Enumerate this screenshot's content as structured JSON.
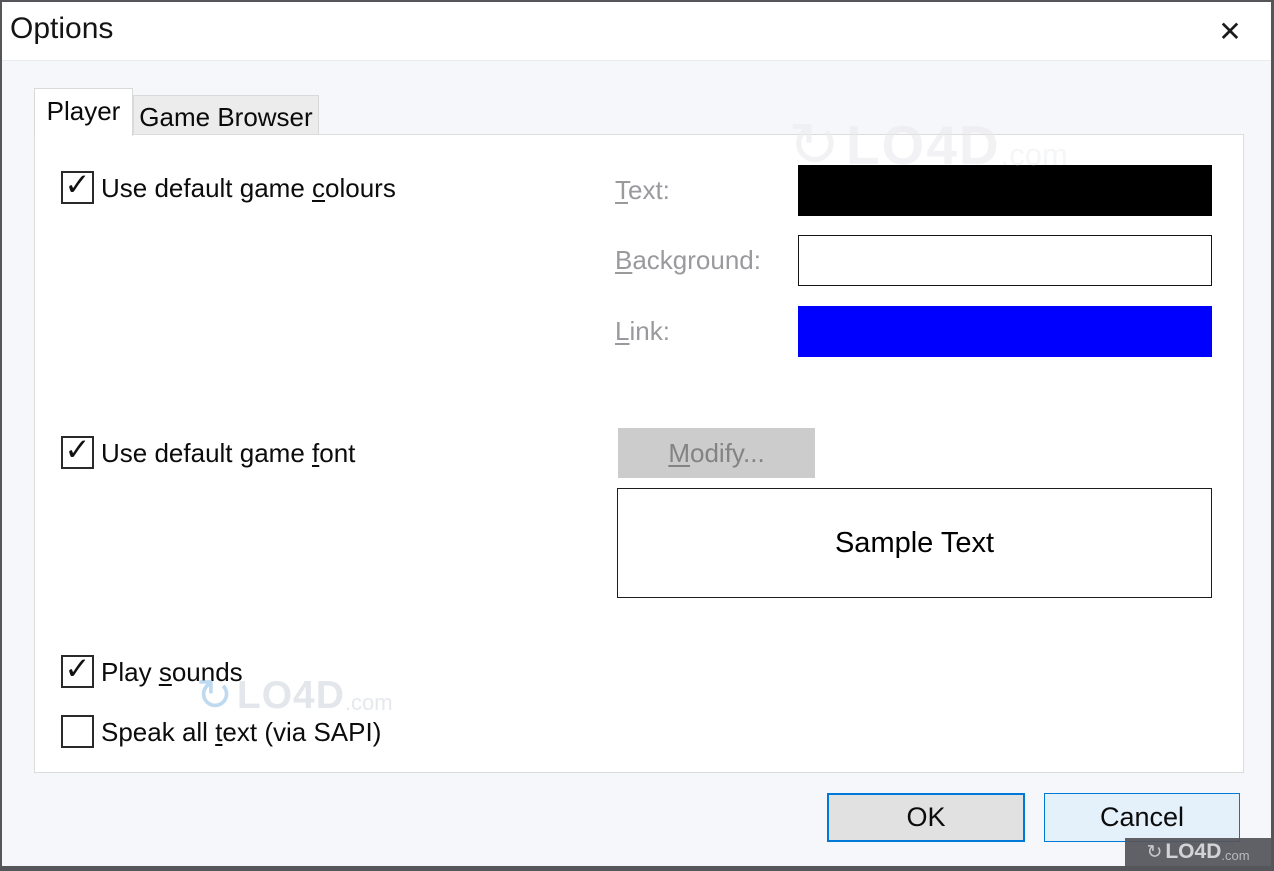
{
  "window": {
    "title": "Options",
    "close_glyph": "✕"
  },
  "tabs": {
    "player": "Player",
    "game_browser": "Game Browser"
  },
  "player_tab": {
    "use_colours": {
      "pre": "Use default game ",
      "accel": "c",
      "post": "olours",
      "check": "✓"
    },
    "rows": {
      "text": {
        "accel": "T",
        "post": "ext:",
        "color": "#000000"
      },
      "background": {
        "accel": "B",
        "post": "ackground:",
        "color": "#ffffff"
      },
      "link": {
        "accel": "L",
        "post": "ink:",
        "color": "#0000ff"
      }
    },
    "use_font": {
      "pre": "Use default game ",
      "accel": "f",
      "post": "ont",
      "check": "✓"
    },
    "modify_button": {
      "accel": "M",
      "post": "odify..."
    },
    "sample_text": "Sample Text",
    "play_sounds": {
      "pre": "Play ",
      "accel": "s",
      "post": "ounds",
      "check": "✓"
    },
    "speak_sapi": {
      "pre": "Speak all ",
      "accel": "t",
      "post": "ext (via SAPI)",
      "check": ""
    }
  },
  "footer": {
    "ok": "OK",
    "cancel": "Cancel"
  },
  "watermark": {
    "icon": "↻",
    "name": "LO4D",
    "tld": ".com"
  },
  "colors": {
    "accent_border": "#0078d7",
    "text_swatch": "#000000",
    "background_swatch": "#ffffff",
    "link_swatch": "#0000ff"
  }
}
